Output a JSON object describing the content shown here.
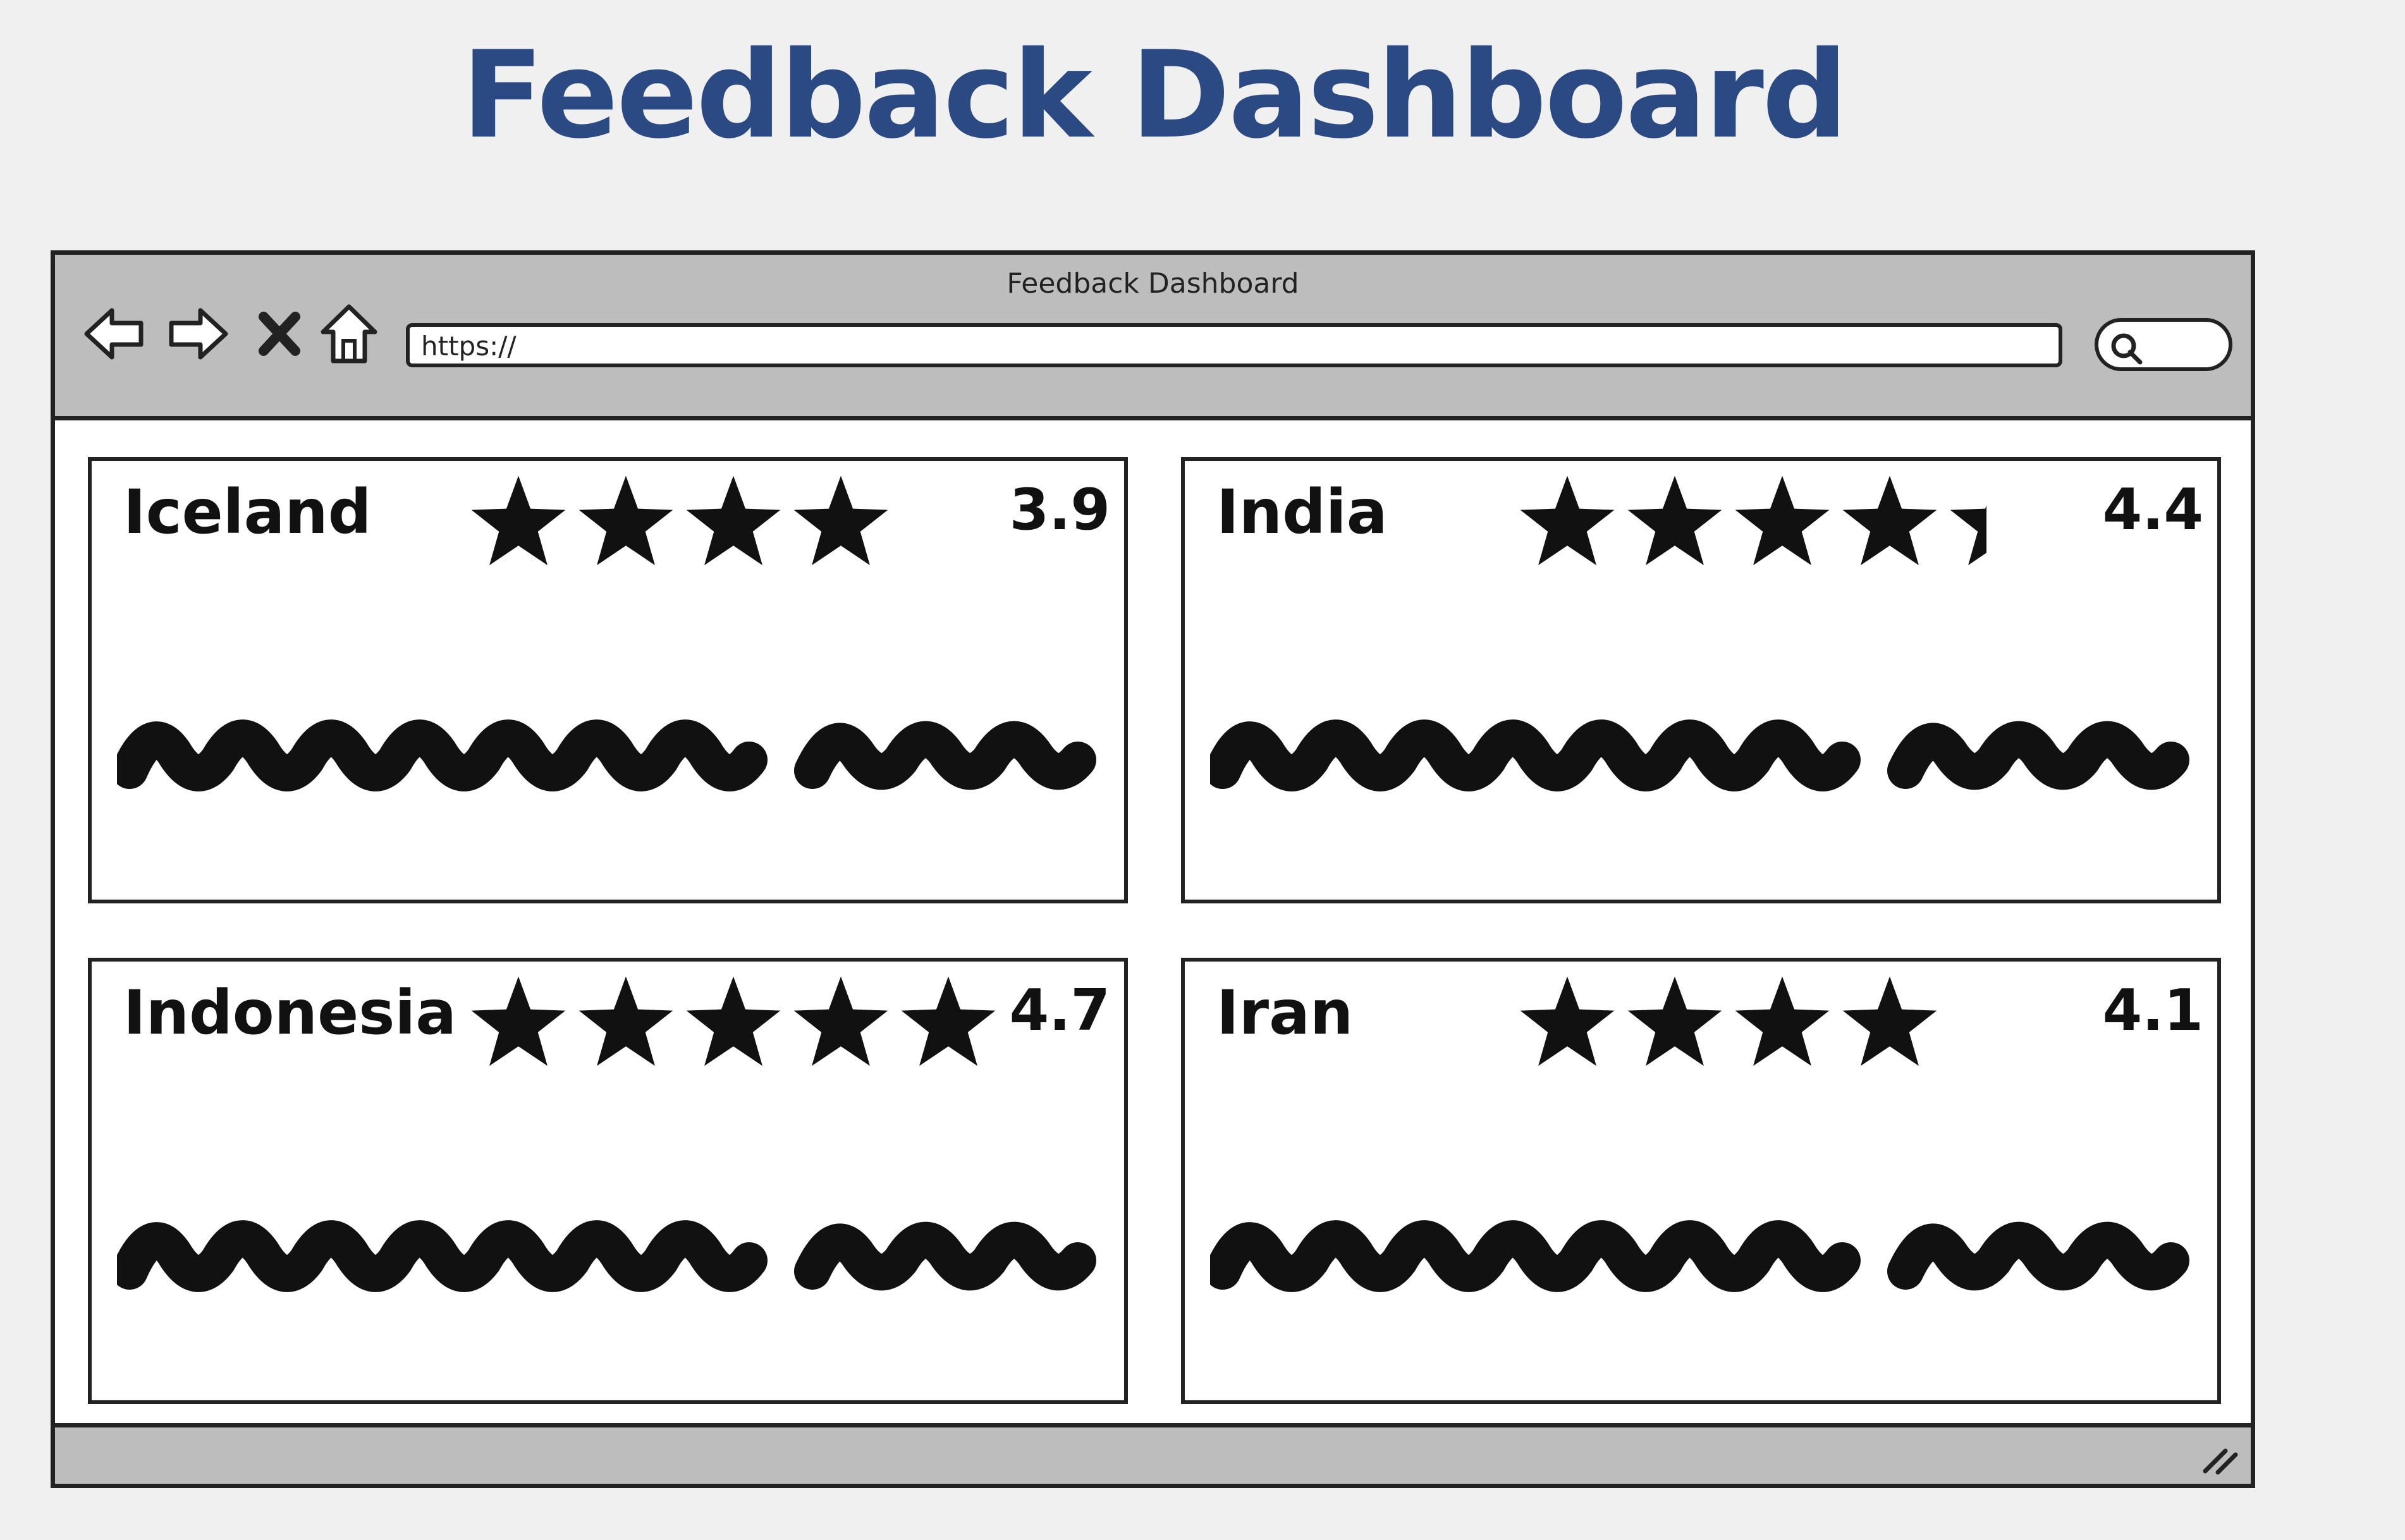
{
  "page": {
    "title": "Feedback Dashboard"
  },
  "browser": {
    "window_title": "Feedback Dashboard",
    "url": "https://",
    "icons": {
      "back": "back-arrow-icon",
      "forward": "forward-arrow-icon",
      "stop": "close-icon",
      "home": "home-icon",
      "search": "search-icon",
      "resize": "resize-grip-icon"
    }
  },
  "cards": [
    {
      "country": "Iceland",
      "rating": "3.9",
      "stars": 4,
      "star_icon": "star-icon",
      "comment_icon": "scribbled-text-placeholder"
    },
    {
      "country": "India",
      "rating": "4.4",
      "stars": 4.4,
      "star_icon": "star-icon",
      "comment_icon": "scribbled-text-placeholder"
    },
    {
      "country": "Indonesia",
      "rating": "4.7",
      "stars": 5,
      "star_icon": "star-icon",
      "comment_icon": "scribbled-text-placeholder"
    },
    {
      "country": "Iran",
      "rating": "4.1",
      "stars": 4,
      "star_icon": "star-icon",
      "comment_icon": "scribbled-text-placeholder"
    }
  ],
  "colors": {
    "title": "#2b4a84",
    "chrome": "#bdbdbd",
    "ink": "#111111",
    "background": "#f0f0f0"
  }
}
